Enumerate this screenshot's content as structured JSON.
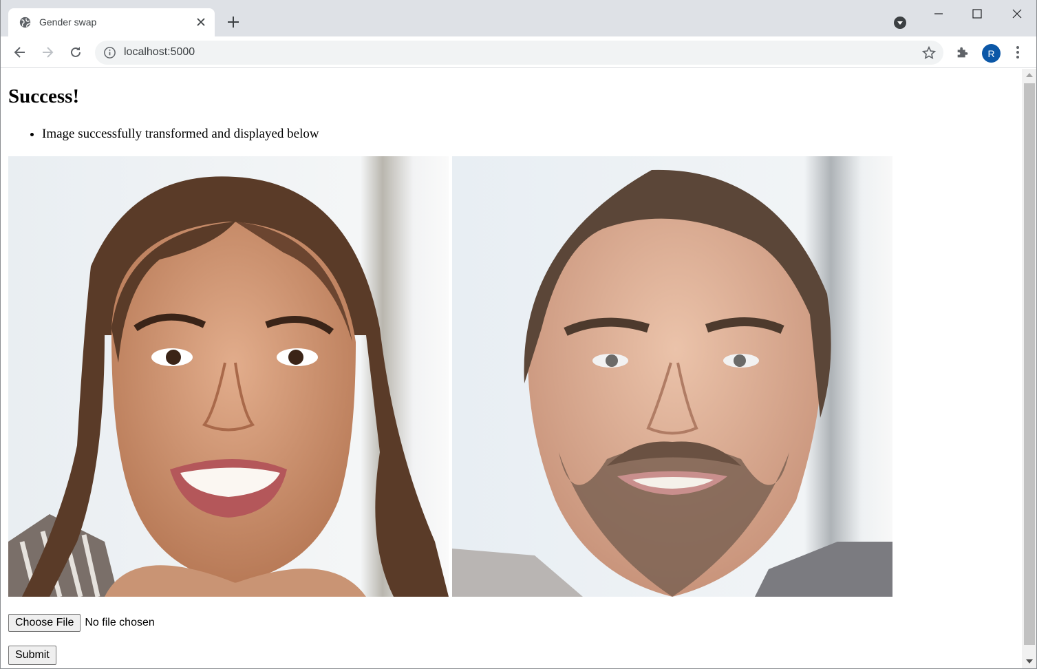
{
  "browser": {
    "tab": {
      "title": "Gender swap",
      "icon": "globe-icon"
    },
    "address_bar": {
      "url": "localhost:5000"
    },
    "profile_initial": "R",
    "accent_color": "#0b57a7"
  },
  "page": {
    "heading": "Success!",
    "messages": [
      "Image successfully transformed and displayed below"
    ],
    "images": [
      {
        "name": "original-face-photo",
        "subject": "smiling woman with long brown hair"
      },
      {
        "name": "transformed-face-photo",
        "subject": "smiling man with short brown hair and beard"
      }
    ],
    "file_input": {
      "button_label": "Choose File",
      "status": "No file chosen"
    },
    "submit_label": "Submit"
  }
}
